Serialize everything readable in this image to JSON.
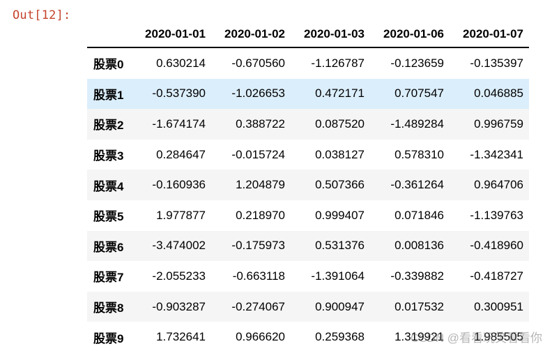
{
  "cell": {
    "out_prompt": "Out[12]:"
  },
  "dataframe": {
    "columns": [
      "2020-01-01",
      "2020-01-02",
      "2020-01-03",
      "2020-01-06",
      "2020-01-07"
    ],
    "rows": [
      {
        "index": "股票0",
        "values": [
          "0.630214",
          "-0.670560",
          "-1.126787",
          "-0.123659",
          "-0.135397"
        ]
      },
      {
        "index": "股票1",
        "values": [
          "-0.537390",
          "-1.026653",
          "0.472171",
          "0.707547",
          "0.046885"
        ]
      },
      {
        "index": "股票2",
        "values": [
          "-1.674174",
          "0.388722",
          "0.087520",
          "-1.489284",
          "0.996759"
        ]
      },
      {
        "index": "股票3",
        "values": [
          "0.284647",
          "-0.015724",
          "0.038127",
          "0.578310",
          "-1.342341"
        ]
      },
      {
        "index": "股票4",
        "values": [
          "-0.160936",
          "1.204879",
          "0.507366",
          "-0.361264",
          "0.964706"
        ]
      },
      {
        "index": "股票5",
        "values": [
          "1.977877",
          "0.218970",
          "0.999407",
          "0.071846",
          "-1.139763"
        ]
      },
      {
        "index": "股票6",
        "values": [
          "-3.474002",
          "-0.175973",
          "0.531376",
          "0.008136",
          "-0.418960"
        ]
      },
      {
        "index": "股票7",
        "values": [
          "-2.055233",
          "-0.663118",
          "-1.391064",
          "-0.339882",
          "-0.418727"
        ]
      },
      {
        "index": "股票8",
        "values": [
          "-0.903287",
          "-0.274067",
          "0.900947",
          "0.017532",
          "0.300951"
        ]
      },
      {
        "index": "股票9",
        "values": [
          "1.732641",
          "0.966620",
          "0.259368",
          "1.319921",
          "1.985505"
        ]
      }
    ],
    "hovered_row_index": "股票1"
  },
  "watermark": {
    "text": "CSDN @看看玩笑看看你"
  },
  "colors": {
    "out_prompt": "#c4432b",
    "hover_row": "#dbeefb",
    "striped_row": "#f5f5f5"
  }
}
